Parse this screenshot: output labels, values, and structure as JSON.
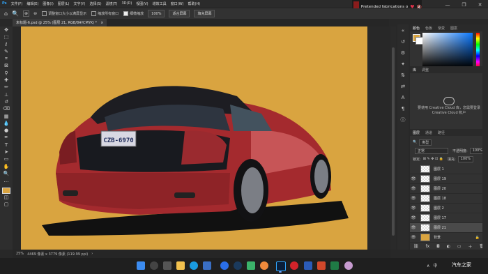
{
  "menu": [
    "文件(F)",
    "编辑(E)",
    "图像(I)",
    "图层(L)",
    "文字(Y)",
    "选择(S)",
    "滤镜(T)",
    "3D(D)",
    "视图(V)",
    "增效工具",
    "窗口(W)",
    "帮助(H)"
  ],
  "notification": {
    "text": "Pretended fabrications o"
  },
  "options": {
    "resize_windows": "调整窗口大小以满屏显示",
    "zoom_all": "缩放所有窗口",
    "scrubby_zoom": "细微缩放",
    "zoom_value": "100%",
    "fit_screen": "适合屏幕",
    "fill_screen": "填充屏幕"
  },
  "document": {
    "tab": "未标题-6.psd @ 25% (图层 21, RGB/8#/CMYK) *"
  },
  "status": {
    "zoom": "25%",
    "doc_size": "4469 像素 x 3779 像素 (119.99 ppi)"
  },
  "swatch_colors": {
    "foreground": "#d9a440",
    "background": "#ffffff"
  },
  "panels": {
    "color_tabs": [
      "颜色",
      "色板",
      "渐变",
      "图案"
    ],
    "library_tabs": [
      "库",
      "调整"
    ],
    "library_text": "要使用 Creative Cloud 库，您需要登录 Creative Cloud 帐户",
    "layers_tabs": [
      "图层",
      "通道",
      "路径"
    ],
    "kind_filter": "类型",
    "blend_mode": "正常",
    "opacity_label": "不透明度:",
    "opacity_value": "100%",
    "lock_label": "锁定:",
    "fill_label": "填充:",
    "fill_value": "100%"
  },
  "layers": [
    {
      "name": "图层 1"
    },
    {
      "name": "图层 19"
    },
    {
      "name": "图层 20"
    },
    {
      "name": "图层 18"
    },
    {
      "name": "图层 2"
    },
    {
      "name": "图层 17"
    },
    {
      "name": "图层 21",
      "selected": true
    },
    {
      "name": "背景"
    }
  ],
  "artwork": {
    "plate": "CZB-6970"
  },
  "tray": {
    "ime": "中",
    "watermark": "汽车之家"
  }
}
